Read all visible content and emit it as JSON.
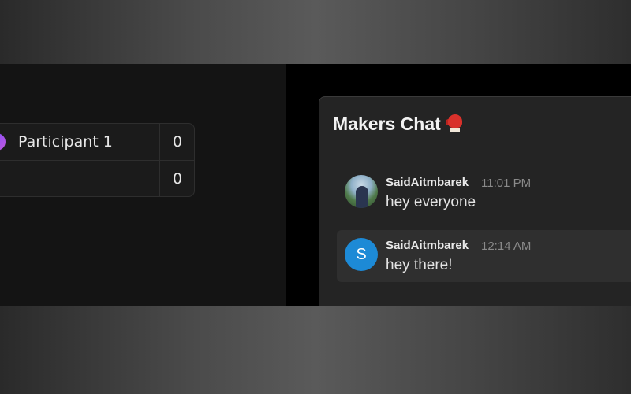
{
  "scoreboard": {
    "rows": [
      {
        "name": "Participant 1",
        "score": "0"
      },
      {
        "name": "",
        "score": "0"
      }
    ]
  },
  "chat": {
    "title": "Makers Chat",
    "title_icon": "boxing-glove-icon",
    "messages": [
      {
        "author": "SaidAitmbarek",
        "time": "11:01 PM",
        "text": "hey everyone",
        "avatar": "photo"
      },
      {
        "author": "SaidAitmbarek",
        "time": "12:14 AM",
        "text": "hey there!",
        "avatar": "S",
        "avatar_color": "#1d8ad6"
      }
    ]
  },
  "colors": {
    "app_background": "#000000",
    "panel_background": "#242424",
    "accent_avatar": "#1d8ad6"
  }
}
